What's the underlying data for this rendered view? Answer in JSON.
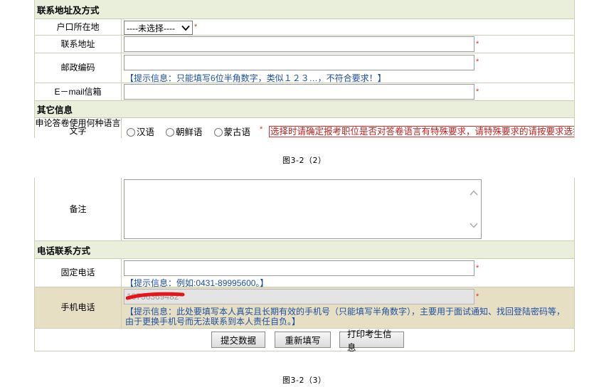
{
  "contact_section": {
    "title": "联系地址及方式",
    "household_label": "户口所在地",
    "household_select": "----未选择----",
    "address_label": "联系地址",
    "postcode_label": "邮政编码",
    "postcode_hint": "【提示信息：只能填写6位半角数字，类似１２３…，不符合要求！】",
    "email_label": "E－mail信箱",
    "required_mark": "*"
  },
  "other_section": {
    "title": "其它信息",
    "language_label": "申论答卷使用何种语言文字",
    "options": [
      "汉语",
      "朝鲜语",
      "蒙古语"
    ],
    "warning": "选择时请确定报考职位是否对答卷语言有特殊要求，请特殊要求的请按要求选择"
  },
  "caption1": "图3-2（2）",
  "remarks": {
    "label": "备注"
  },
  "phone_section": {
    "title": "电话联系方式",
    "landline_label": "固定电话",
    "landline_hint": "【提示信息：例如:0431-89995600。】",
    "mobile_label": "手机电话",
    "mobile_value": "13756369482",
    "mobile_hint_line1": "【提示信息：此处要填写本人真实且长期有效的手机号（只能填写半角数字），主要用于面试通知、找回登陆密码等，",
    "mobile_hint_line2": "由于更换手机号而无法联系到本人责任自负。】"
  },
  "buttons": {
    "submit": "提交数据",
    "reset": "重新填写",
    "print": "打印考生信息"
  },
  "caption2": "图3-2（3）",
  "colors": {
    "section_bg": "#e9efdb",
    "mobile_row_bg": "#e7dfc4",
    "hint_blue": "#1c4fa3",
    "required_red": "#e0302a",
    "redaction": "#e8141a"
  }
}
